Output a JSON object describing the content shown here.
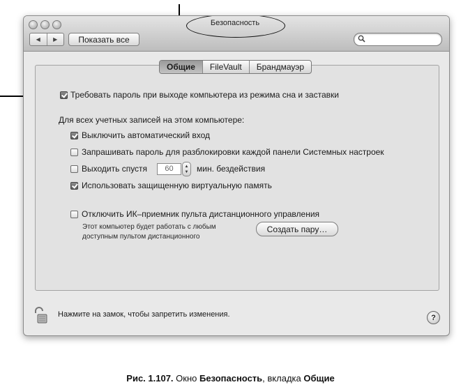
{
  "window": {
    "title": "Безопасность",
    "show_all_label": "Показать все",
    "nav_back": "◀",
    "nav_forward": "▶",
    "search_placeholder": ""
  },
  "tabs": [
    {
      "label": "Общие",
      "active": true
    },
    {
      "label": "FileVault",
      "active": false
    },
    {
      "label": "Брандмауэр",
      "active": false
    }
  ],
  "settings": {
    "require_password": {
      "label": "Требовать пароль при выходе компьютера из режима сна и заставки",
      "checked": true
    },
    "all_accounts_heading": "Для всех учетных записей на этом компьютере:",
    "disable_autologin": {
      "label": "Выключить автоматический вход",
      "checked": true
    },
    "require_password_prefs": {
      "label": "Запрашивать пароль для разблокировки каждой панели Системных настроек",
      "checked": false
    },
    "logout_after": {
      "label_before": "Выходить спустя",
      "value": "60",
      "label_after": "мин. бездействия",
      "checked": false
    },
    "secure_vm": {
      "label": "Использовать защищенную виртуальную память",
      "checked": true
    },
    "disable_ir": {
      "label": "Отключить ИК–приемник пульта дистанционного управления",
      "checked": false
    },
    "ir_note_line1": "Этот компьютер будет работать с любым",
    "ir_note_line2": "доступным пультом дистанционного",
    "pair_button": "Создать пару…"
  },
  "footer": {
    "lock_text": "Нажмите на замок, чтобы запретить изменения.",
    "help_label": "?"
  },
  "caption": {
    "prefix": "Рис. 1.107.",
    "text1": " Окно ",
    "bold1": "Безопасность",
    "text2": ", вкладка ",
    "bold2": "Общие"
  },
  "colors": {
    "window_bg": "#e9e9e9",
    "toolbar": "#bdbdbd",
    "checkbox_checked": "#5d5d5d"
  }
}
